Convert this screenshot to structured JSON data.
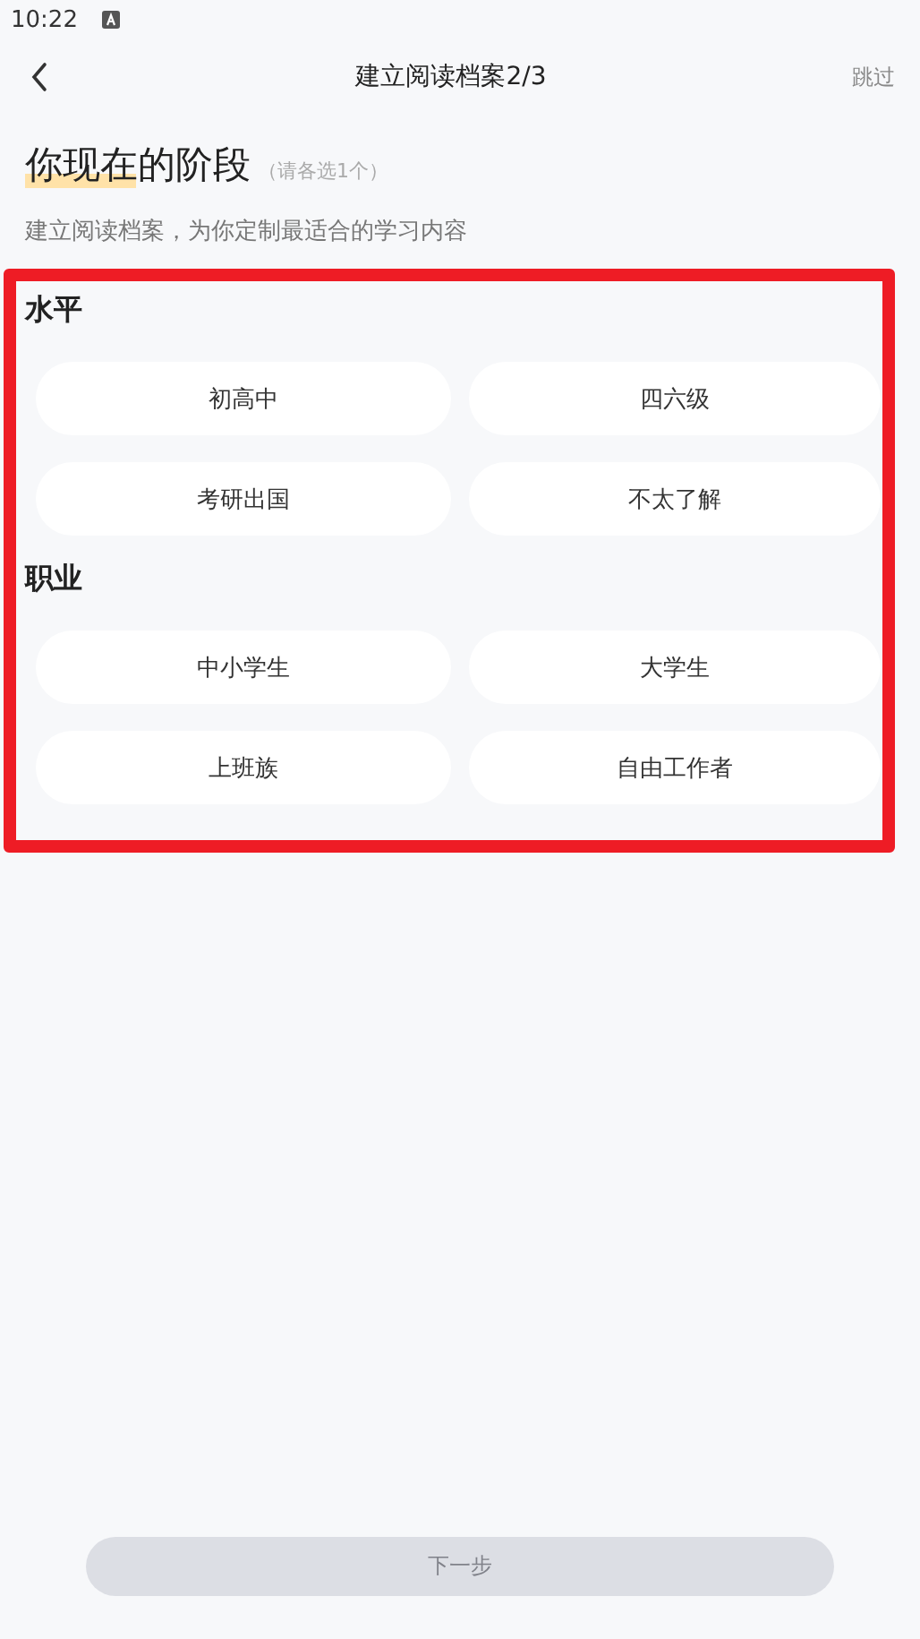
{
  "status_bar": {
    "time": "10:22"
  },
  "nav": {
    "title": "建立阅读档案2/3",
    "skip": "跳过"
  },
  "heading": {
    "title": "你现在的阶段",
    "hint": "（请各选1个）",
    "subtitle": "建立阅读档案，为你定制最适合的学习内容"
  },
  "sections": [
    {
      "title": "水平",
      "options": [
        {
          "label": "初高中",
          "selected": false
        },
        {
          "label": "四六级",
          "selected": false
        },
        {
          "label": "考研出国",
          "selected": false
        },
        {
          "label": "不太了解",
          "selected": false
        }
      ]
    },
    {
      "title": "职业",
      "options": [
        {
          "label": "中小学生",
          "selected": false
        },
        {
          "label": "大学生",
          "selected": false
        },
        {
          "label": "上班族",
          "selected": false
        },
        {
          "label": "自由工作者",
          "selected": false
        }
      ]
    }
  ],
  "next_button": {
    "label": "下一步",
    "disabled": true
  }
}
